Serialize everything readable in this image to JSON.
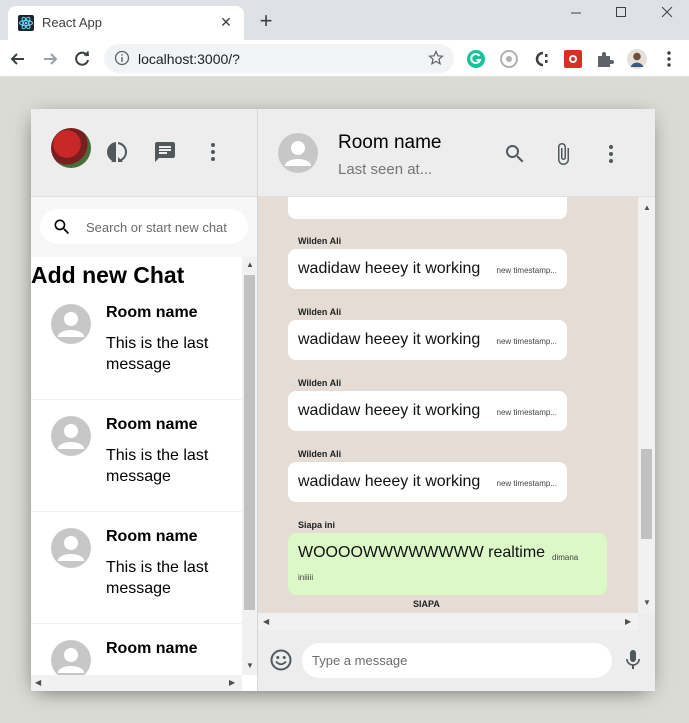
{
  "browser": {
    "tab_title": "React App",
    "tab_close": "✕",
    "new_tab": "+",
    "url": "localhost:3000/?"
  },
  "sidebar": {
    "search_placeholder": "Search or start new chat",
    "add_new_chat": "Add new Chat",
    "chats": [
      {
        "name": "Room name",
        "last_message": "This is the last message"
      },
      {
        "name": "Room name",
        "last_message": "This is the last message"
      },
      {
        "name": "Room name",
        "last_message": "This is the last message"
      },
      {
        "name": "Room name",
        "last_message": ""
      }
    ]
  },
  "chat": {
    "room_name": "Room name",
    "status": "Last seen at...",
    "messages": [
      {
        "sender": "Wilden Ali",
        "text": "wadidaw heeey it working",
        "time": "new timestamp..."
      },
      {
        "sender": "Wilden Ali",
        "text": "wadidaw heeey it working",
        "time": "new timestamp..."
      },
      {
        "sender": "Wilden Ali",
        "text": "wadidaw heeey it working",
        "time": "new timestamp..."
      },
      {
        "sender": "Wilden Ali",
        "text": "wadidaw heeey it working",
        "time": "new timestamp..."
      },
      {
        "sender": "Siapa ini",
        "text": "WOOOOWWWWWWWW realtime",
        "time": "dimana iniiiii"
      }
    ],
    "next_sender": "SIAPA",
    "input_placeholder": "Type a message"
  },
  "colors": {
    "chat_bg": "#e5ddd5",
    "sent_bubble": "#dcf8c6",
    "received_bubble": "#ffffff",
    "header_bg": "#ededed"
  }
}
